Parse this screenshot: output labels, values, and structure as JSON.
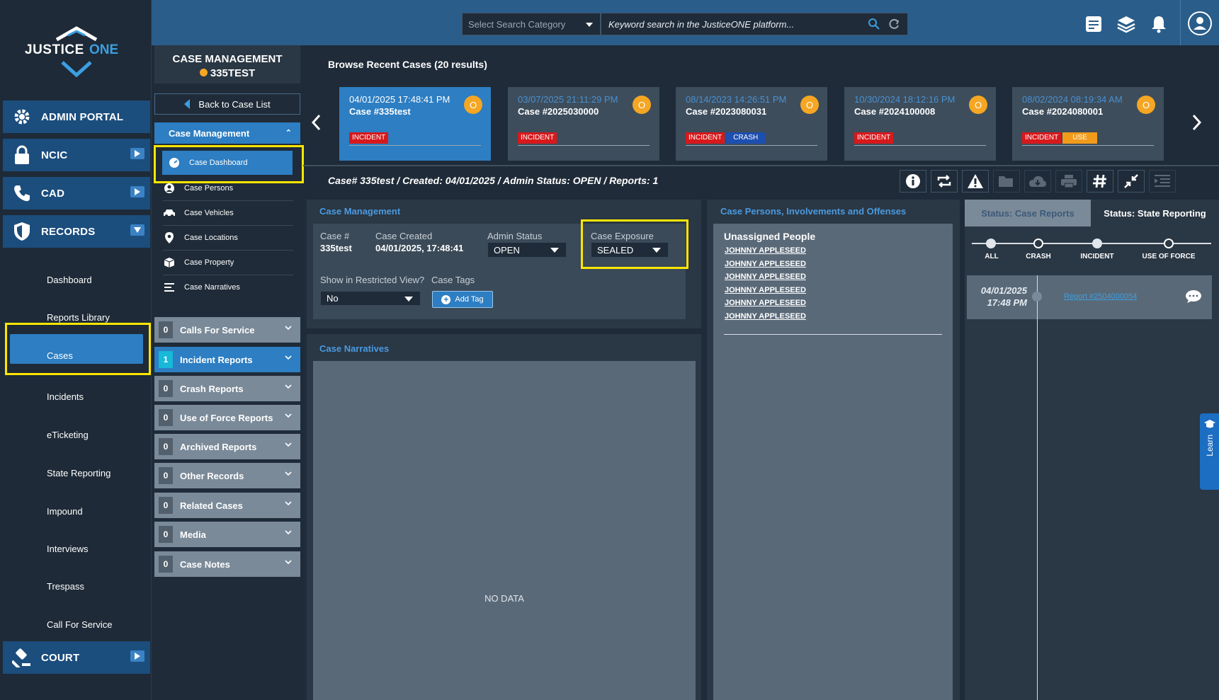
{
  "app": {
    "logo_text": "JUSTICEONE"
  },
  "topbar": {
    "search_category_placeholder": "Select Search Category",
    "search_placeholder": "Keyword search in the JusticeONE platform..."
  },
  "leftnav": {
    "admin": "ADMIN PORTAL",
    "ncic": "NCIC",
    "cad": "CAD",
    "records": "RECORDS",
    "court": "COURT",
    "records_items": [
      "Dashboard",
      "Reports Library",
      "Cases",
      "Incidents",
      "eTicketing",
      "State Reporting",
      "Impound",
      "Interviews",
      "Trespass",
      "Call For Service"
    ]
  },
  "casepanel": {
    "title": "CASE MANAGEMENT",
    "case_id": "335TEST",
    "back": "Back to Case List",
    "section": "Case Management",
    "menu": [
      "Case Dashboard",
      "Case Persons",
      "Case Vehicles",
      "Case Locations",
      "Case Property",
      "Case Narratives"
    ],
    "accordions": [
      {
        "count": "0",
        "label": "Calls For Service"
      },
      {
        "count": "1",
        "label": "Incident Reports"
      },
      {
        "count": "0",
        "label": "Crash Reports"
      },
      {
        "count": "0",
        "label": "Use of Force Reports"
      },
      {
        "count": "0",
        "label": "Archived Reports"
      },
      {
        "count": "0",
        "label": "Other Records"
      },
      {
        "count": "0",
        "label": "Related Cases"
      },
      {
        "count": "0",
        "label": "Media"
      },
      {
        "count": "0",
        "label": "Case Notes"
      }
    ]
  },
  "recent": {
    "title": "Browse Recent Cases (20 results)",
    "cards": [
      {
        "date": "04/01/2025 17:48:41 PM",
        "case": "Case #335test",
        "badge": "O",
        "tags": [
          "INCIDENT"
        ]
      },
      {
        "date": "03/07/2025 21:11:29 PM",
        "case": "Case #2025030000",
        "badge": "O",
        "tags": [
          "INCIDENT"
        ]
      },
      {
        "date": "08/14/2023 14:26:51 PM",
        "case": "Case #2023080031",
        "badge": "O",
        "tags": [
          "INCIDENT",
          "CRASH"
        ]
      },
      {
        "date": "10/30/2024 18:12:16 PM",
        "case": "Case #2024100008",
        "badge": "O",
        "tags": [
          "INCIDENT"
        ]
      },
      {
        "date": "08/02/2024 08:19:34 AM",
        "case": "Case #2024080001",
        "badge": "O",
        "tags": [
          "INCIDENT",
          "USE"
        ]
      }
    ]
  },
  "caseinfo": "Case# 335test / Created: 04/01/2025 / Admin Status: OPEN / Reports: 1",
  "casemgmt": {
    "title": "Case Management",
    "case_no_label": "Case #",
    "case_no": "335test",
    "created_label": "Case Created",
    "created": "04/01/2025, 17:48:41",
    "admin_label": "Admin Status",
    "admin": "OPEN",
    "exposure_label": "Case Exposure",
    "exposure": "SEALED",
    "restricted_label": "Show in Restricted View?",
    "restricted": "No",
    "tags_label": "Case Tags",
    "add_tag": "Add Tag"
  },
  "narratives": {
    "title": "Case Narratives",
    "empty": "NO DATA"
  },
  "persons": {
    "title": "Case Persons, Involvements and Offenses",
    "unassigned": "Unassigned People",
    "people": [
      "JOHNNY APPLESEED",
      "JOHNNY APPLESEED",
      "JOHNNY APPLESEED",
      "JOHNNY APPLESEED",
      "JOHNNY APPLESEED",
      "JOHNNY APPLESEED"
    ]
  },
  "reports": {
    "tab1": "Status: Case Reports",
    "tab2": "Status: State Reporting",
    "filters": [
      "ALL",
      "CRASH",
      "INCIDENT",
      "USE OF FORCE"
    ],
    "entry_date": "04/01/2025",
    "entry_time": "17:48 PM",
    "entry_link": "Report #2504000054"
  },
  "learn": "Learn",
  "colors": {
    "accent": "#2d7ec2",
    "nav": "#1b4d7d",
    "highlight": "#ffe600",
    "badge": "#f5a623",
    "incident": "#d7191c"
  }
}
